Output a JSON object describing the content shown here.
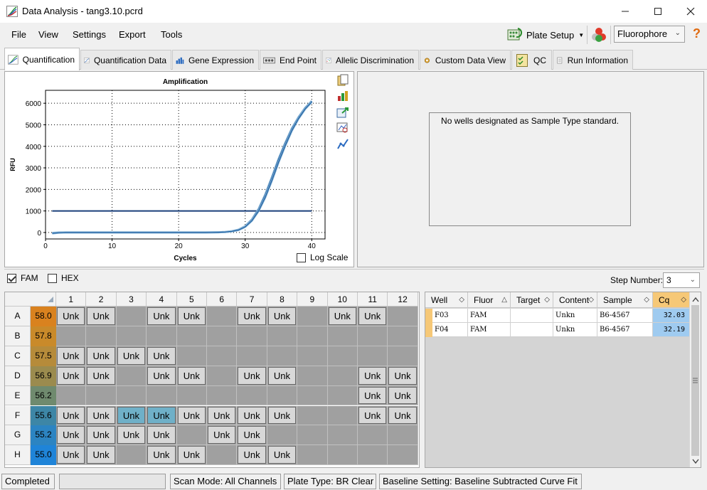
{
  "window": {
    "title": "Data Analysis - tang3.10.pcrd"
  },
  "menu": {
    "items": [
      "File",
      "View",
      "Settings",
      "Export",
      "Tools"
    ]
  },
  "toolbar": {
    "plate_setup": "Plate Setup",
    "fluorophore": "Fluorophore",
    "help": "?"
  },
  "tabs": [
    {
      "label": "Quantification",
      "icon": "amplification-icon",
      "active": true
    },
    {
      "label": "Quantification Data",
      "icon": "data-table-icon",
      "active": false
    },
    {
      "label": "Gene Expression",
      "icon": "bar-chart-icon",
      "active": false
    },
    {
      "label": "End Point",
      "icon": "end-point-icon",
      "active": false
    },
    {
      "label": "Allelic Discrimination",
      "icon": "scatter-icon",
      "active": false
    },
    {
      "label": "Custom Data View",
      "icon": "gear-icon",
      "active": false
    },
    {
      "label": "QC",
      "icon": "checklist-icon",
      "active": false
    },
    {
      "label": "Run Information",
      "icon": "document-icon",
      "active": false
    }
  ],
  "chart_data": {
    "type": "line",
    "title": "Amplification",
    "xlabel": "Cycles",
    "ylabel": "RFU",
    "xlim": [
      0,
      42
    ],
    "ylim": [
      -300,
      6600
    ],
    "xticks": [
      0,
      10,
      20,
      30,
      40
    ],
    "yticks": [
      0,
      1000,
      2000,
      3000,
      4000,
      5000,
      6000
    ],
    "grid": true,
    "threshold": 1000,
    "series": [
      {
        "x": [
          1,
          2,
          3,
          4,
          5,
          6,
          7,
          8,
          9,
          10,
          11,
          12,
          13,
          14,
          15,
          16,
          17,
          18,
          19,
          20,
          21,
          22,
          23,
          24,
          25,
          26,
          27,
          28,
          29,
          30,
          31,
          32,
          33,
          34,
          35,
          36,
          37,
          38,
          39,
          40
        ],
        "y": [
          -20,
          0,
          0,
          0,
          0,
          0,
          0,
          0,
          0,
          0,
          0,
          0,
          0,
          0,
          0,
          0,
          0,
          0,
          0,
          0,
          0,
          0,
          0,
          0,
          5,
          10,
          25,
          60,
          130,
          290,
          600,
          1080,
          1750,
          2550,
          3400,
          4150,
          4820,
          5350,
          5780,
          6100
        ]
      },
      {
        "x": [
          1,
          2,
          3,
          4,
          5,
          6,
          7,
          8,
          9,
          10,
          11,
          12,
          13,
          14,
          15,
          16,
          17,
          18,
          19,
          20,
          21,
          22,
          23,
          24,
          25,
          26,
          27,
          28,
          29,
          30,
          31,
          32,
          33,
          34,
          35,
          36,
          37,
          38,
          39,
          40
        ],
        "y": [
          -40,
          -10,
          0,
          0,
          0,
          0,
          0,
          0,
          0,
          0,
          0,
          0,
          0,
          0,
          0,
          0,
          0,
          0,
          0,
          0,
          0,
          0,
          0,
          0,
          5,
          10,
          22,
          52,
          115,
          260,
          545,
          990,
          1620,
          2400,
          3250,
          4020,
          4720,
          5280,
          5730,
          6060
        ]
      }
    ],
    "colors": {
      "curve": "#1f5fa0",
      "threshold": "#1a3f7a",
      "curve_shadow": "#8ab6d8"
    }
  },
  "chart_options": {
    "log_scale_label": "Log Scale",
    "log_scale_checked": false
  },
  "standard_curve": {
    "message": "No wells designated as Sample Type standard."
  },
  "fluor_filter": {
    "fam": "FAM",
    "fam_checked": true,
    "hex": "HEX",
    "hex_checked": false
  },
  "step": {
    "label": "Step Number:",
    "value": "3"
  },
  "plate": {
    "columns": [
      "1",
      "2",
      "3",
      "4",
      "5",
      "6",
      "7",
      "8",
      "9",
      "10",
      "11",
      "12"
    ],
    "rows": [
      {
        "label": "A",
        "temp": "58.0",
        "color": "#d9821f",
        "wells": [
          "Unk",
          "Unk",
          "",
          "Unk",
          "Unk",
          "",
          "Unk",
          "Unk",
          "",
          "Unk",
          "Unk",
          ""
        ]
      },
      {
        "label": "B",
        "temp": "57.8",
        "color": "#c98a2a",
        "wells": [
          "",
          "",
          "",
          "",
          "",
          "",
          "",
          "",
          "",
          "",
          "",
          ""
        ]
      },
      {
        "label": "C",
        "temp": "57.5",
        "color": "#b68b3a",
        "wells": [
          "Unk",
          "Unk",
          "Unk",
          "Unk",
          "",
          "",
          "",
          "",
          "",
          "",
          "",
          ""
        ]
      },
      {
        "label": "D",
        "temp": "56.9",
        "color": "#9b8b4e",
        "wells": [
          "Unk",
          "Unk",
          "",
          "Unk",
          "Unk",
          "",
          "Unk",
          "Unk",
          "",
          "",
          "Unk",
          "Unk"
        ]
      },
      {
        "label": "E",
        "temp": "56.2",
        "color": "#6f8a6e",
        "wells": [
          "",
          "",
          "",
          "",
          "",
          "",
          "",
          "",
          "",
          "",
          "Unk",
          "Unk"
        ]
      },
      {
        "label": "F",
        "temp": "55.6",
        "color": "#3d86a6",
        "wells": [
          "Unk",
          "Unk",
          "Unk",
          "Unk",
          "Unk",
          "Unk",
          "Unk",
          "Unk",
          "",
          "",
          "Unk",
          "Unk"
        ]
      },
      {
        "label": "G",
        "temp": "55.2",
        "color": "#2c84c2",
        "wells": [
          "Unk",
          "Unk",
          "Unk",
          "Unk",
          "",
          "Unk",
          "Unk",
          "",
          "",
          "",
          "",
          ""
        ]
      },
      {
        "label": "H",
        "temp": "55.0",
        "color": "#1f84d8",
        "wells": [
          "Unk",
          "Unk",
          "",
          "Unk",
          "Unk",
          "",
          "Unk",
          "Unk",
          "",
          "",
          "",
          ""
        ]
      }
    ],
    "selected": [
      "F3",
      "F4"
    ]
  },
  "results": {
    "columns": [
      "Well",
      "Fluor",
      "Target",
      "Content",
      "Sample",
      "Cq"
    ],
    "rows": [
      {
        "well": "F03",
        "fluor": "FAM",
        "target": "",
        "content": "Unkn",
        "sample": "B6-4567",
        "cq": "32.03"
      },
      {
        "well": "F04",
        "fluor": "FAM",
        "target": "",
        "content": "Unkn",
        "sample": "B6-4567",
        "cq": "32.19"
      }
    ]
  },
  "status": {
    "state": "Completed",
    "scan_mode": "Scan Mode: All Channels",
    "plate_type": "Plate Type: BR Clear",
    "baseline": "Baseline Setting: Baseline Subtracted Curve Fit"
  }
}
